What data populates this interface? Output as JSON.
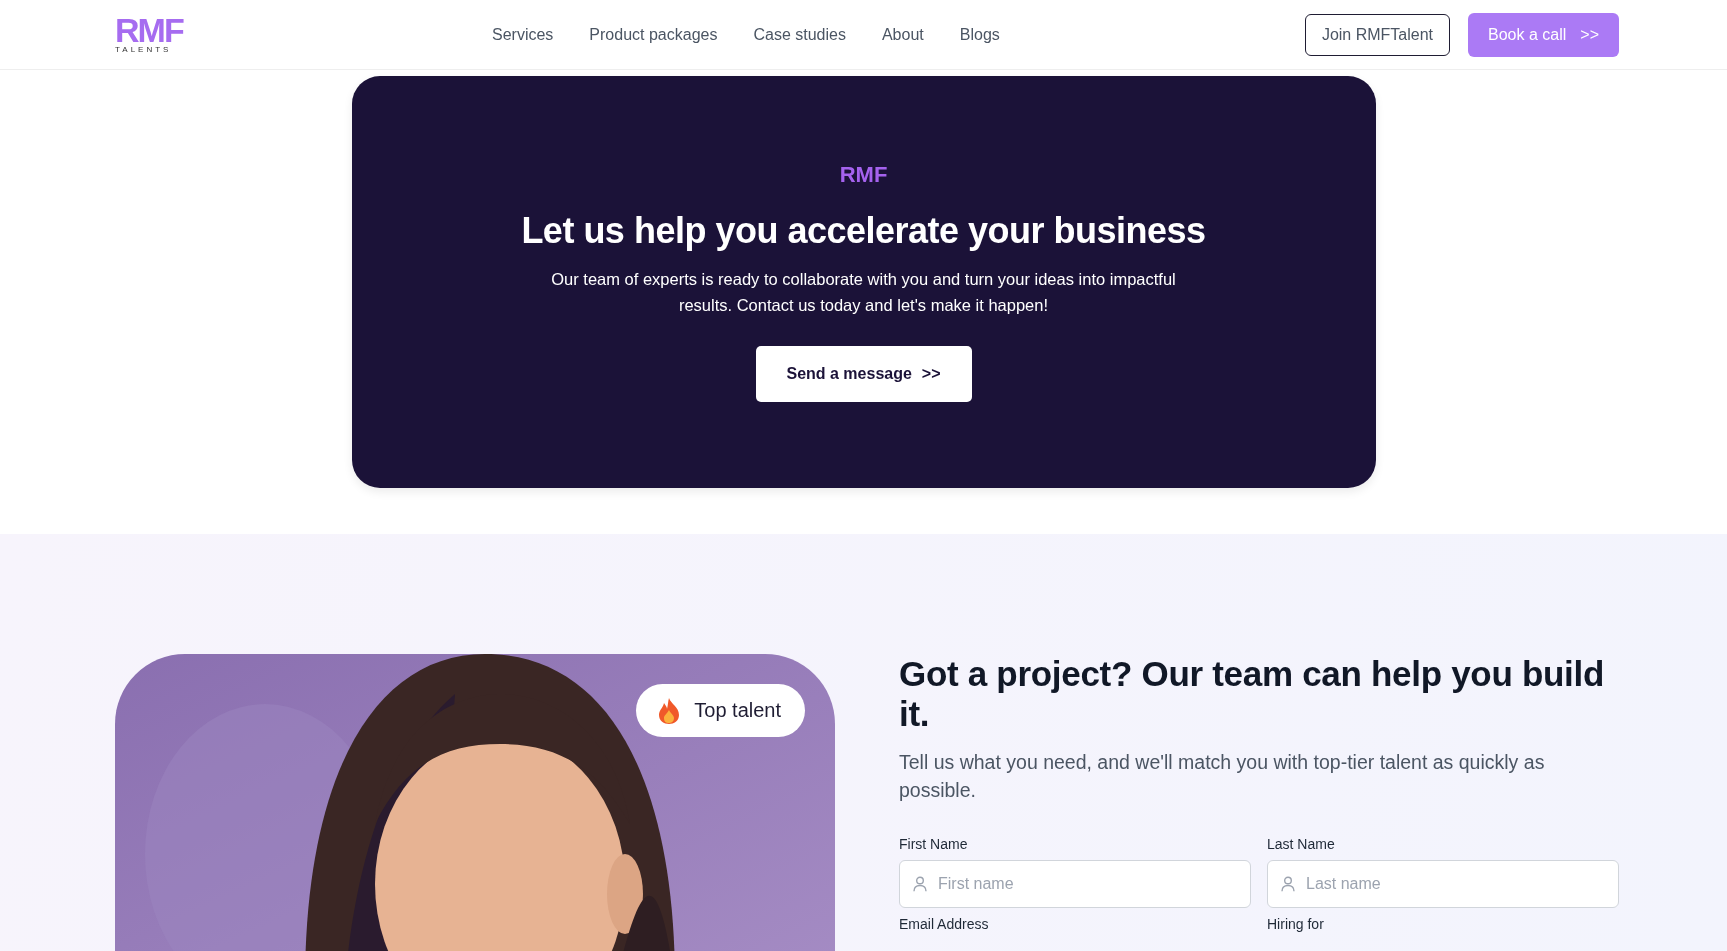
{
  "header": {
    "logo": {
      "mark": "RMF",
      "subtitle": "TALENTS"
    },
    "nav": [
      {
        "label": "Services"
      },
      {
        "label": "Product packages"
      },
      {
        "label": "Case studies"
      },
      {
        "label": "About"
      },
      {
        "label": "Blogs"
      }
    ],
    "actions": {
      "join": "Join RMFTalent",
      "book": "Book a call",
      "book_arrow": ">>"
    }
  },
  "cta": {
    "eyebrow": "RMF",
    "title": "Let us help you accelerate your business",
    "text": "Our team of experts is ready to collaborate with you and turn your ideas into impactful results. Contact us today and let's make it happen!",
    "button": "Send a message",
    "button_arrow": ">>"
  },
  "contact": {
    "image": {
      "kind": "picture",
      "badge": "Top talent"
    },
    "title": "Got a project? Our team can help you build it.",
    "subtitle": "Tell us what you need, and we'll match you with top-tier talent as quickly as possible.",
    "fields": [
      {
        "label": "First Name",
        "placeholder": "First name",
        "kind": "person"
      },
      {
        "label": "Last Name",
        "placeholder": "Last name",
        "kind": "person"
      },
      {
        "label": "Email Address",
        "kind": "cut"
      },
      {
        "label": "Hiring for",
        "kind": "cut"
      }
    ]
  }
}
